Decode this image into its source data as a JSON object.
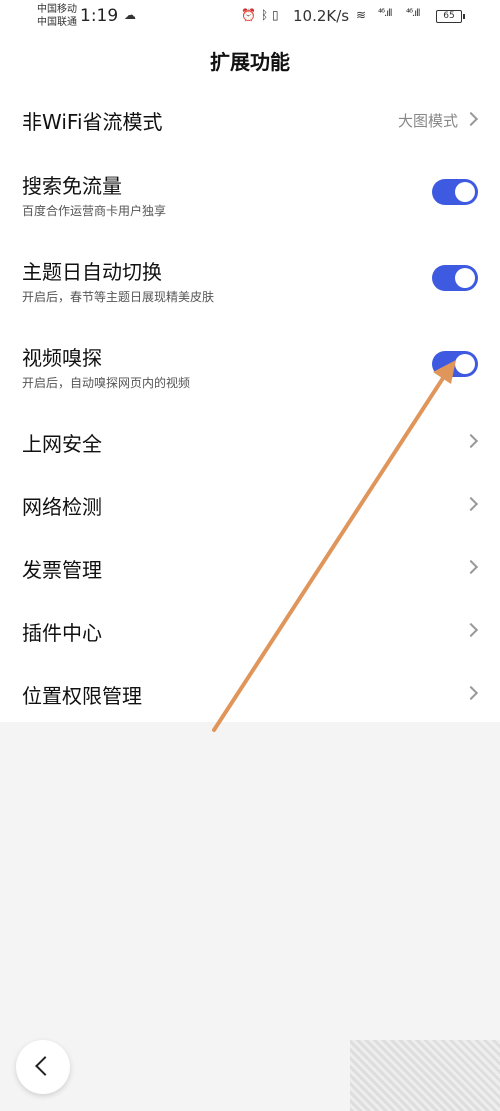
{
  "status_bar": {
    "carrier1": "中国移动",
    "carrier2": "中国联通",
    "time": "1:19",
    "net_speed": "10.2K/s",
    "signal1": "⁴⁶.ıll",
    "signal2": "⁴⁶.ıll",
    "battery": "65"
  },
  "header": {
    "title": "扩展功能"
  },
  "settings": [
    {
      "label": "非WiFi省流模式",
      "value": "大图模式",
      "kind": "link"
    },
    {
      "label": "搜索免流量",
      "sub": "百度合作运营商卡用户独享",
      "kind": "toggle",
      "on": true
    },
    {
      "label": "主题日自动切换",
      "sub": "开启后，春节等主题日展现精美皮肤",
      "kind": "toggle",
      "on": true
    },
    {
      "label": "视频嗅探",
      "sub": "开启后，自动嗅探网页内的视频",
      "kind": "toggle",
      "on": true
    },
    {
      "label": "上网安全",
      "kind": "link"
    },
    {
      "label": "网络检测",
      "kind": "link"
    },
    {
      "label": "发票管理",
      "kind": "link"
    },
    {
      "label": "插件中心",
      "kind": "link"
    },
    {
      "label": "位置权限管理",
      "kind": "link"
    }
  ],
  "colors": {
    "toggle_on": "#3d5ae0",
    "annotation_arrow": "#e0955a"
  },
  "icons": {
    "back": "chevron-left-icon",
    "row_arrow": "chevron-right-icon"
  }
}
